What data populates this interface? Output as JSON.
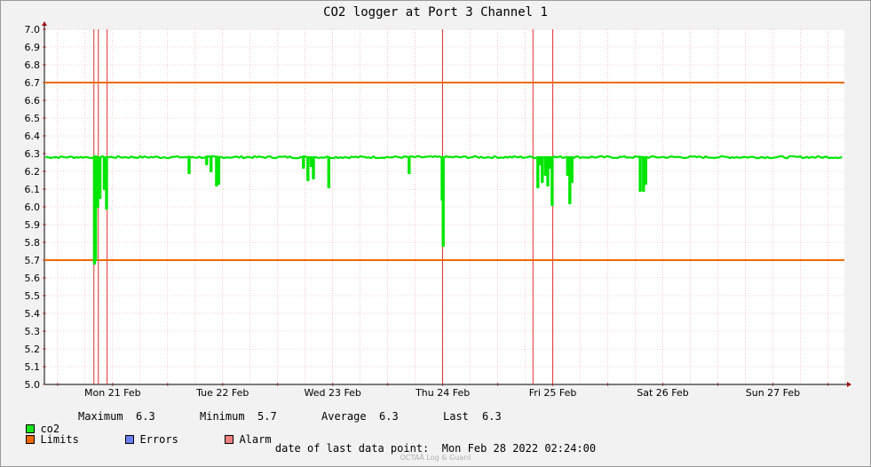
{
  "chart_data": {
    "type": "line",
    "title": "CO2 logger at Port 3 Channel 1",
    "ylim": [
      5.0,
      7.0
    ],
    "y_ticks": [
      "5.0",
      "5.1",
      "5.2",
      "5.3",
      "5.4",
      "5.5",
      "5.6",
      "5.7",
      "5.8",
      "5.9",
      "6.0",
      "6.1",
      "6.2",
      "6.3",
      "6.4",
      "6.5",
      "6.6",
      "6.7",
      "6.8",
      "6.9",
      "7.0"
    ],
    "x_range_days": [
      -0.62,
      6.65
    ],
    "x_tick_labels": [
      {
        "label": "Mon 21 Feb",
        "day": 0
      },
      {
        "label": "Tue 22 Feb",
        "day": 1
      },
      {
        "label": "Wed 23 Feb",
        "day": 2
      },
      {
        "label": "Thu 24 Feb",
        "day": 3
      },
      {
        "label": "Fri 25 Feb",
        "day": 4
      },
      {
        "label": "Sat 26 Feb",
        "day": 5
      },
      {
        "label": "Sun 27 Feb",
        "day": 6
      }
    ],
    "grid": true,
    "series": [
      {
        "name": "co2",
        "color": "#00e600",
        "baseline": 6.28,
        "dips": [
          {
            "day": -0.17,
            "value": 5.68
          },
          {
            "day": -0.16,
            "value": 5.7
          },
          {
            "day": -0.14,
            "value": 6.0
          },
          {
            "day": -0.12,
            "value": 6.05
          },
          {
            "day": -0.08,
            "value": 6.1
          },
          {
            "day": -0.06,
            "value": 5.99
          },
          {
            "day": 0.69,
            "value": 6.19
          },
          {
            "day": 0.85,
            "value": 6.24
          },
          {
            "day": 0.89,
            "value": 6.2
          },
          {
            "day": 0.94,
            "value": 6.12
          },
          {
            "day": 0.96,
            "value": 6.13
          },
          {
            "day": 1.73,
            "value": 6.22
          },
          {
            "day": 1.77,
            "value": 6.15
          },
          {
            "day": 1.8,
            "value": 6.23
          },
          {
            "day": 1.82,
            "value": 6.16
          },
          {
            "day": 1.96,
            "value": 6.11
          },
          {
            "day": 2.69,
            "value": 6.19
          },
          {
            "day": 2.99,
            "value": 6.04
          },
          {
            "day": 3.0,
            "value": 5.78
          },
          {
            "day": 3.86,
            "value": 6.11
          },
          {
            "day": 3.88,
            "value": 6.24
          },
          {
            "day": 3.9,
            "value": 6.14
          },
          {
            "day": 3.93,
            "value": 6.18
          },
          {
            "day": 3.95,
            "value": 6.12
          },
          {
            "day": 3.97,
            "value": 6.22
          },
          {
            "day": 3.99,
            "value": 6.01
          },
          {
            "day": 4.13,
            "value": 6.18
          },
          {
            "day": 4.15,
            "value": 6.02
          },
          {
            "day": 4.17,
            "value": 6.14
          },
          {
            "day": 4.79,
            "value": 6.09
          },
          {
            "day": 4.82,
            "value": 6.09
          },
          {
            "day": 4.84,
            "value": 6.13
          }
        ]
      },
      {
        "name": "Limits",
        "color": "#ee6a00",
        "type": "hline",
        "values": [
          6.7,
          5.7
        ]
      }
    ],
    "alarm_color": "#e03030",
    "alarm_lines_days": [
      -0.17,
      -0.13,
      -0.05,
      2.999,
      3.82,
      4.0
    ]
  },
  "legend": {
    "co2": {
      "label": "co2",
      "color": "#19e619"
    },
    "stats": [
      {
        "name": "Maximum",
        "value": "6.3"
      },
      {
        "name": "Minimum",
        "value": "5.7"
      },
      {
        "name": "Average",
        "value": "6.3"
      },
      {
        "name": "Last",
        "value": "6.3"
      }
    ],
    "limits": {
      "label": "Limits",
      "color": "#ee6a00"
    },
    "errors": {
      "label": "Errors",
      "color": "#6b7ff0"
    },
    "alarm": {
      "label": "Alarm",
      "color": "#f08080"
    }
  },
  "footer": {
    "last_point_label": "date of last data point:",
    "last_point_value": "Mon Feb 28 2022 02:24:00",
    "watermark": "OCTAÄ Log & Guard"
  }
}
